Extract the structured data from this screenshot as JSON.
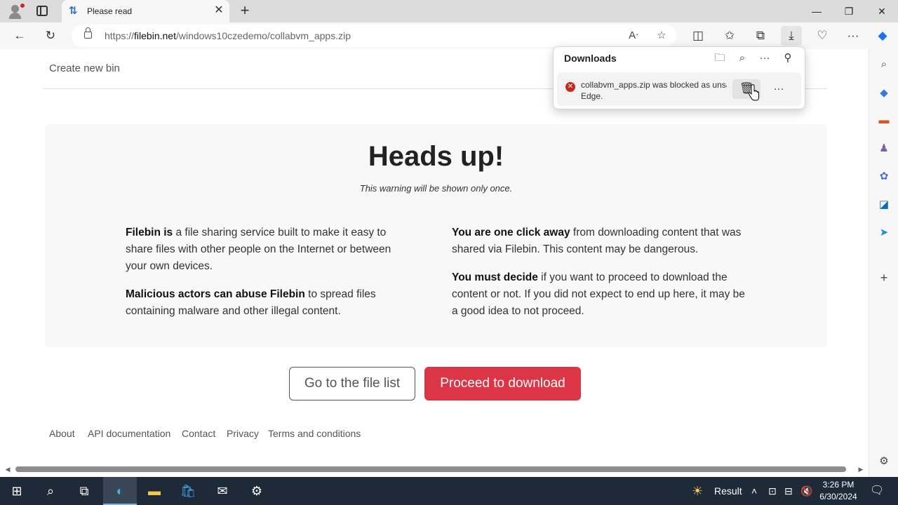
{
  "browser": {
    "tab_title": "Please read",
    "url_scheme": "https://",
    "url_domain": "filebin.net",
    "url_path": "/windows10czedemo/collabvm_apps.zip"
  },
  "downloads": {
    "title": "Downloads",
    "item_line1": "collabvm_apps.zip was blocked as unsafe by Microsoft",
    "item_line2": "Edge."
  },
  "page": {
    "create_bin": "Create new bin",
    "heading": "Heads up!",
    "subheading": "This warning will be shown only once.",
    "left": {
      "p1_bold": "Filebin is",
      "p1_text": " a file sharing service built to make it easy to share files with other people on the Internet or between your own devices.",
      "p2_bold": "Malicious actors can abuse Filebin",
      "p2_text": " to spread files containing malware and other illegal content."
    },
    "right": {
      "p1_bold": "You are one click away",
      "p1_text": " from downloading content that was shared via Filebin. This content may be dangerous.",
      "p2_bold": "You must decide",
      "p2_text": " if you want to proceed to download the content or not. If you did not expect to end up here, it may be a good idea to not proceed."
    },
    "btn_file_list": "Go to the file list",
    "btn_proceed": "Proceed to download"
  },
  "footer": {
    "about": "About",
    "api": "API documentation",
    "contact": "Contact",
    "privacy": "Privacy",
    "terms": "Terms and conditions"
  },
  "taskbar": {
    "weather_label": "Result",
    "time": "3:26 PM",
    "date": "6/30/2024"
  },
  "colors": {
    "proceed_button": "#dc3545",
    "taskbar": "#1f2a38",
    "error_badge": "#c42b1c"
  }
}
